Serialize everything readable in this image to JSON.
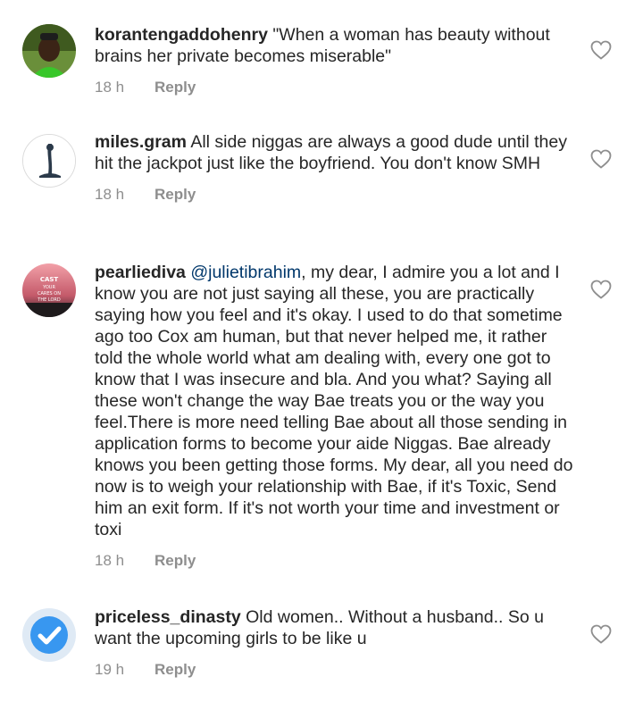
{
  "comments": [
    {
      "username": "korantengaddohenry",
      "text": "\"When a woman has beauty without brains her private becomes miserable\"",
      "time": "18 h",
      "reply_label": "Reply",
      "like_icon": "heart-outline-icon"
    },
    {
      "username": "miles.gram",
      "text": "All side niggas are always a good dude until they hit the jackpot just like the boyfriend. You don't know SMH",
      "time": "18 h",
      "reply_label": "Reply",
      "like_icon": "heart-outline-icon"
    },
    {
      "username": "pearliediva",
      "mention": "@julietibrahim",
      "text": ", my dear, I admire you a lot and I know you are not just saying all these, you are practically saying how you feel and it's okay. I used to do that sometime ago too Cox am human, but that never helped me, it rather told the whole world what am dealing with, every one got to know that I was insecure and bla. And you what? Saying all these won't change the way Bae treats you or the way you feel.There is more need telling Bae about all those sending in application forms to become your aide Niggas. Bae already knows you been getting those forms. My dear, all you need do now is to weigh your relationship with Bae, if it's Toxic, Send him an exit form. If it's not worth your time and investment or toxi",
      "time": "18 h",
      "reply_label": "Reply",
      "like_icon": "heart-outline-icon",
      "avatar_text": "CAST YOUR CARES ON THE LORD"
    },
    {
      "username": "priceless_dinasty",
      "text": "Old women.. Without a husband.. So u want the upcoming girls to be like u",
      "time": "19 h",
      "reply_label": "Reply",
      "like_icon": "heart-outline-icon"
    }
  ],
  "colors": {
    "text": "#262626",
    "meta": "#8e8e8e",
    "mention": "#00376b",
    "verified_blue": "#3897f0"
  }
}
